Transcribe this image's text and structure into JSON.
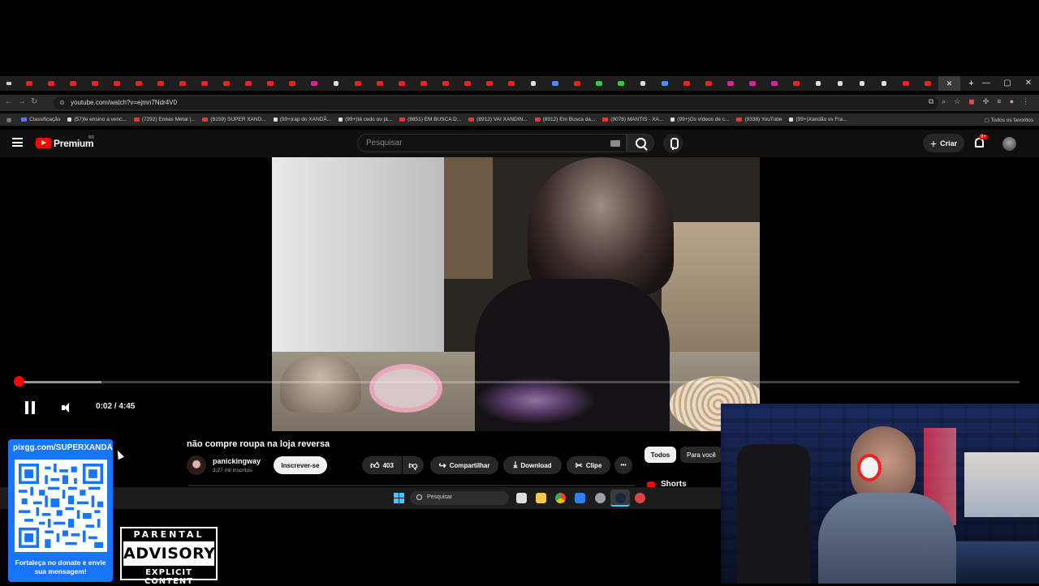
{
  "browser": {
    "url": "youtube.com/watch?v=ejmn7Ndr4V0",
    "tabs": [
      "yt",
      "yt",
      "yt",
      "yt",
      "yt",
      "yt",
      "yt",
      "yt",
      "yt",
      "yt",
      "yt",
      "yt",
      "yt",
      "ig",
      "tt",
      "yt",
      "yt",
      "yt",
      "yt",
      "yt",
      "yt",
      "yt",
      "yt",
      "tt",
      "bl",
      "yt",
      "gr",
      "gr",
      "tt",
      "bl",
      "yt",
      "yt",
      "ig",
      "ig",
      "ig",
      "yt",
      "tt",
      "tt",
      "tt",
      "tt",
      "yt",
      "yt"
    ],
    "bookmarks": [
      {
        "icon": "b",
        "label": "Classificação"
      },
      {
        "icon": "t",
        "label": "(57)fe ensino a venc..."
      },
      {
        "icon": "y",
        "label": "(7292) Enéas Metal |..."
      },
      {
        "icon": "y",
        "label": "(8159) SUPER XAND..."
      },
      {
        "icon": "t",
        "label": "(99+)rap do XANDÃ..."
      },
      {
        "icon": "t",
        "label": "(99+)tá cedo ou já..."
      },
      {
        "icon": "y",
        "label": "(8851) EM BUSCA D..."
      },
      {
        "icon": "y",
        "label": "(8912) VAI XANDIN..."
      },
      {
        "icon": "y",
        "label": "(8912) Em Busca da..."
      },
      {
        "icon": "y",
        "label": "(9078) MANTIS - XA..."
      },
      {
        "icon": "t",
        "label": "(99+)Os vídeos de c..."
      },
      {
        "icon": "y",
        "label": "(9338) YouTube"
      },
      {
        "icon": "t",
        "label": "(99+)Xandão vs Fra..."
      }
    ],
    "all_bookmarks": "Todos os favoritos"
  },
  "youtube": {
    "brand": "Premium",
    "country": "BR",
    "search_placeholder": "Pesquisar",
    "create_label": "Criar",
    "notif_badge": "9+"
  },
  "player": {
    "time": "0:02 / 4:45",
    "progress_fraction": 0.0073,
    "buffer_fraction": 0.085
  },
  "video": {
    "title": "não compre roupa na loja reversa",
    "channel": "panickingway",
    "subscribers": "3,27 mil inscritos",
    "subscribe_label": "Inscrever-se",
    "likes": "403",
    "share_label": "Compartilhar",
    "download_label": "Download",
    "clip_label": "Clipe",
    "more_label": "•••"
  },
  "sidebar": {
    "chips": [
      "Todos",
      "Para você"
    ],
    "shorts_label": "Shorts"
  },
  "taskbar": {
    "search_placeholder": "Pesquisar"
  },
  "overlay": {
    "donate_url": "pixgg.com/SUPERXANDÃ",
    "donate_message": "Fortaleça no donate e envie sua mensagem!",
    "pa_top": "PARENTAL",
    "pa_mid": "ADVISORY",
    "pa_bottom": "EXPLICIT CONTENT"
  },
  "colors": {
    "youtube_red": "#ff0000",
    "donate_blue": "#1875ff",
    "webcam_blue": "#1b2b60"
  }
}
